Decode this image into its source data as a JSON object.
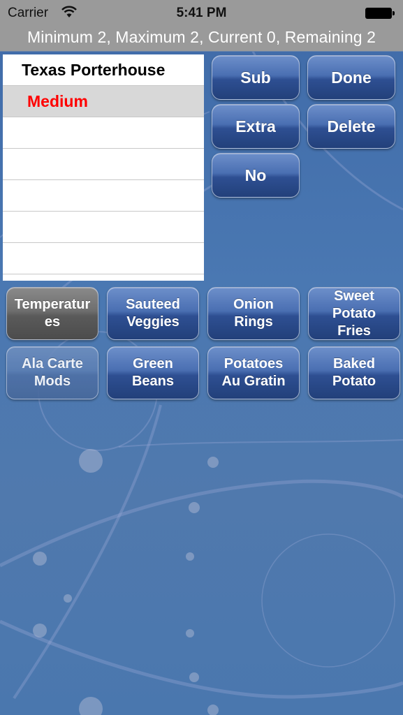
{
  "status_bar": {
    "carrier": "Carrier",
    "time": "5:41 PM",
    "wifi_icon": "wifi-icon",
    "battery_icon": "battery-icon"
  },
  "header": {
    "limits_text": "Minimum 2, Maximum 2, Current 0, Remaining 2"
  },
  "order_list": {
    "item_title": "Texas Porterhouse",
    "selected_modifier": "Medium",
    "selected_color": "#ff0000",
    "empty_rows": 5
  },
  "actions": {
    "sub": "Sub",
    "done": "Done",
    "extra": "Extra",
    "delete": "Delete",
    "no": "No"
  },
  "categories": [
    {
      "label": "Temperatures",
      "state": "selected"
    },
    {
      "label": "Sauteed Veggies",
      "state": "normal"
    },
    {
      "label": "Onion Rings",
      "state": "normal"
    },
    {
      "label": "Sweet Potato Fries",
      "state": "normal"
    },
    {
      "label": "Ala Carte Mods",
      "state": "faded"
    },
    {
      "label": "Green Beans",
      "state": "normal"
    },
    {
      "label": "Potatoes Au Gratin",
      "state": "normal"
    },
    {
      "label": "Baked Potato",
      "state": "normal"
    }
  ],
  "colors": {
    "top_bar": "#9a9a9a",
    "background": "#4a76ad",
    "button_blue": "#2e4f92",
    "button_gray": "#6e6e6e"
  }
}
